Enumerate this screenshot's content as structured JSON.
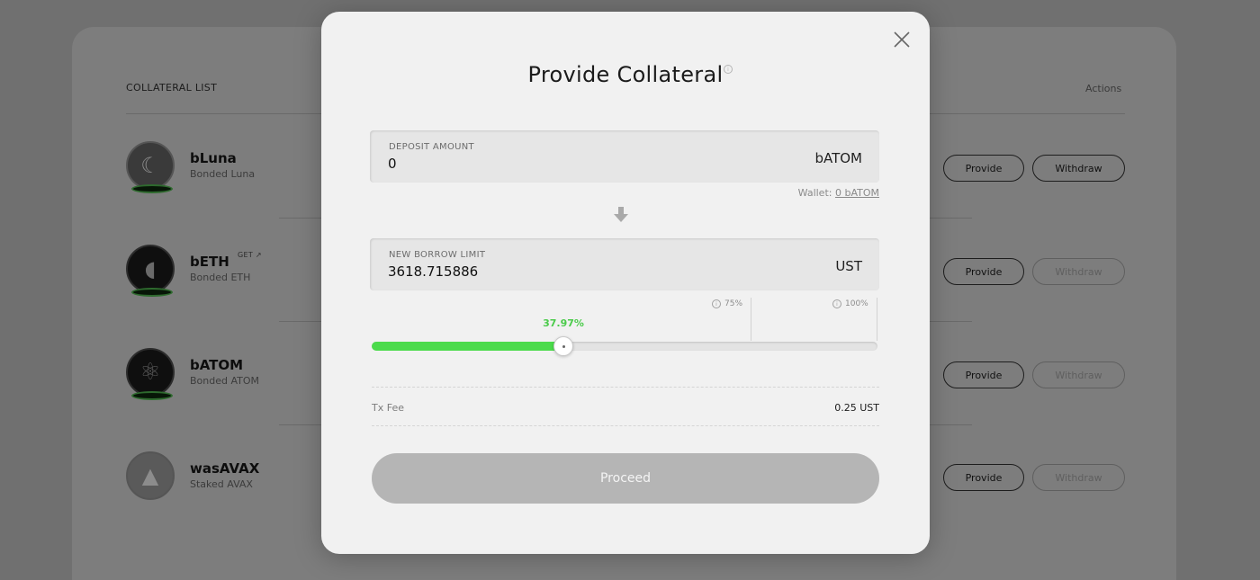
{
  "background": {
    "list_title": "COLLATERAL LIST",
    "actions_header": "Actions",
    "rows": [
      {
        "symbol": "bLuna",
        "description": "Bonded Luna",
        "logo_icon": "bluna-logo-icon",
        "provide_label": "Provide",
        "withdraw_label": "Withdraw",
        "withdraw_enabled": true
      },
      {
        "symbol": "bETH",
        "description": "Bonded ETH",
        "logo_icon": "beth-logo-icon",
        "get_label": "GET",
        "provide_label": "Provide",
        "withdraw_label": "Withdraw",
        "withdraw_enabled": false
      },
      {
        "symbol": "bATOM",
        "description": "Bonded ATOM",
        "logo_icon": "batom-logo-icon",
        "provide_label": "Provide",
        "withdraw_label": "Withdraw",
        "withdraw_enabled": false
      },
      {
        "symbol": "wasAVAX",
        "description": "Staked AVAX",
        "logo_icon": "wasavax-logo-icon",
        "provide_label": "Provide",
        "withdraw_label": "Withdraw",
        "withdraw_enabled": false
      }
    ]
  },
  "modal": {
    "title": "Provide Collateral",
    "deposit": {
      "label": "DEPOSIT AMOUNT",
      "value": "0",
      "unit": "bATOM"
    },
    "wallet": {
      "label": "Wallet:",
      "balance": "0 bATOM"
    },
    "borrow_limit": {
      "label": "NEW BORROW LIMIT",
      "value": "3618.715886",
      "unit": "UST"
    },
    "slider": {
      "value_pct": 37.97,
      "value_label": "37.97%",
      "marks": [
        {
          "label": "75%",
          "pct": 75
        },
        {
          "label": "100%",
          "pct": 100
        }
      ],
      "fill_color": "#4bdb4b"
    },
    "tx_fee": {
      "label": "Tx Fee",
      "value": "0.25 UST"
    },
    "proceed_label": "Proceed"
  }
}
